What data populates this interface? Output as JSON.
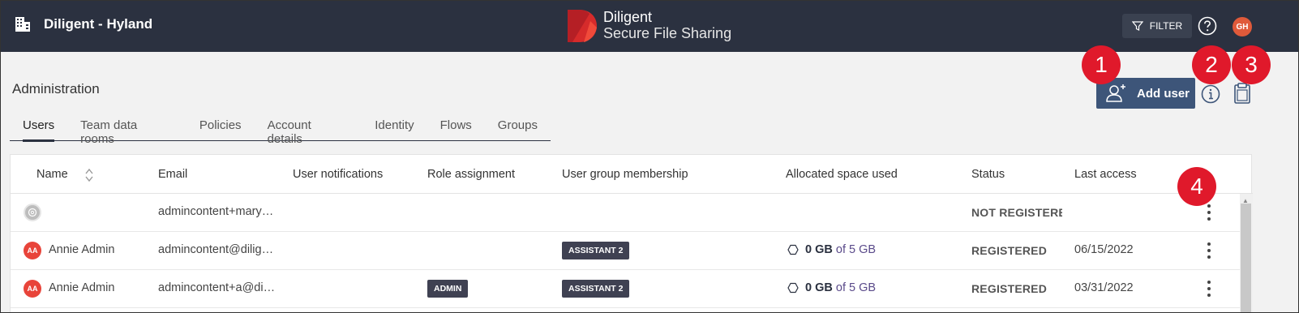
{
  "topbar": {
    "org_name": "Diligent - Hyland",
    "brand_name": "Diligent",
    "brand_sub": "Secure File Sharing",
    "filter_label": "FILTER",
    "user_initials": "GH"
  },
  "page": {
    "title": "Administration",
    "add_user_label": "Add user"
  },
  "tabs": [
    {
      "label": "Users",
      "active": true
    },
    {
      "label": "Team data rooms"
    },
    {
      "label": "Policies"
    },
    {
      "label": "Account details"
    },
    {
      "label": "Identity"
    },
    {
      "label": "Flows"
    },
    {
      "label": "Groups"
    }
  ],
  "callouts": [
    "1",
    "2",
    "3",
    "4"
  ],
  "table": {
    "columns": [
      "Name",
      "Email",
      "User notifications",
      "Role assignment",
      "User group membership",
      "Allocated space used",
      "Status",
      "Last access"
    ],
    "rows": [
      {
        "initials": "",
        "name": "",
        "email": "admincontent+mary…",
        "role": "",
        "group": "",
        "space_used": "",
        "space_total": "",
        "status": "NOT REGISTERED",
        "last_access": ""
      },
      {
        "initials": "AA",
        "name": "Annie Admin",
        "email": "admincontent@dilig…",
        "role": "",
        "group": "ASSISTANT 2",
        "space_used": "0 GB",
        "space_total": "of 5 GB",
        "status": "REGISTERED",
        "last_access": "06/15/2022"
      },
      {
        "initials": "AA",
        "name": "Annie Admin",
        "email": "admincontent+a@di…",
        "role": "ADMIN",
        "group": "ASSISTANT 2",
        "space_used": "0 GB",
        "space_total": "of 5 GB",
        "status": "REGISTERED",
        "last_access": "03/31/2022"
      }
    ]
  },
  "colors": {
    "topbar": "#2b3140",
    "primary_button": "#3d5579",
    "callout": "#e0192b",
    "avatar": "#e8443a",
    "badge": "#3f4152"
  }
}
